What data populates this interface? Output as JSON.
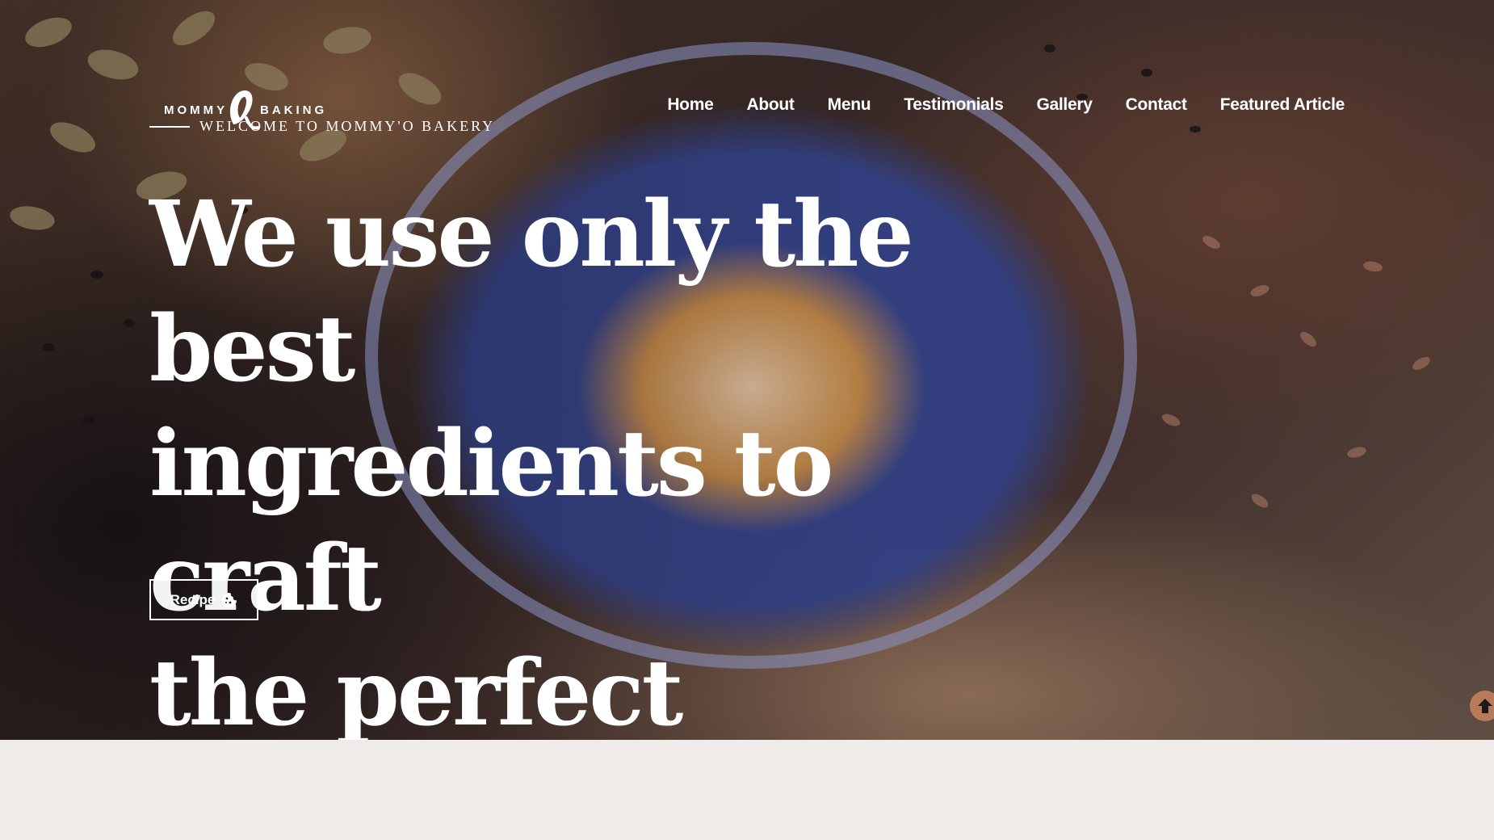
{
  "logo": {
    "word_left": "MOMMY",
    "word_right": "BAKING",
    "tagline": "WELCOME TO MOMMY'O BAKERY"
  },
  "nav": {
    "items": [
      {
        "label": "Home"
      },
      {
        "label": "About"
      },
      {
        "label": "Menu"
      },
      {
        "label": "Testimonials"
      },
      {
        "label": "Gallery"
      },
      {
        "label": "Contact"
      },
      {
        "label": "Featured Article"
      }
    ]
  },
  "hero": {
    "headline_line1": "We use only the best",
    "headline_line2": "ingredients to craft",
    "headline_line3": "the perfect sweets.",
    "button_label": "Recipe",
    "button_icon": "cookie-icon"
  },
  "scroll_top": {
    "icon": "arrow-up-icon"
  },
  "colors": {
    "page_background": "#efebe8",
    "scroll_top_accent": "#b97a5a",
    "bowl_blue": "#37468f",
    "text": "#ffffff"
  }
}
